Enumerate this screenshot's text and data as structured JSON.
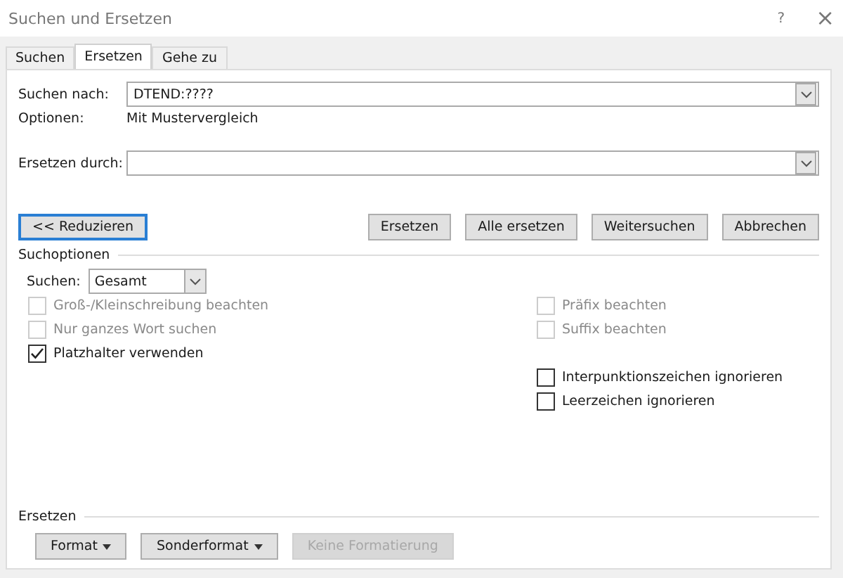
{
  "window": {
    "title": "Suchen und Ersetzen",
    "help": "?",
    "close": "×"
  },
  "tabs": [
    {
      "label": "Suchen",
      "selected": false
    },
    {
      "label": "Ersetzen",
      "selected": true
    },
    {
      "label": "Gehe zu",
      "selected": false
    }
  ],
  "search_field": {
    "label": "Suchen nach:",
    "value": "DTEND:????"
  },
  "options_info": {
    "label": "Optionen:",
    "value": "Mit Mustervergleich"
  },
  "replace_field": {
    "label": "Ersetzen durch:"
  },
  "reduce_button": {
    "label": "<< Reduzieren",
    "focused": true
  },
  "action_buttons": [
    "Ersetzen",
    "Alle ersetzen",
    "Weitersuchen",
    "Abbrechen"
  ],
  "search_options": {
    "title": "Suchoptionen",
    "direction_label": "Suchen:",
    "direction_value": "Gesamt",
    "left_options": [
      {
        "label": "Groß-/Kleinschreibung beachten",
        "checked": false,
        "disabled": true
      },
      {
        "label": "Nur ganzes Wort suchen",
        "checked": false,
        "disabled": true
      },
      {
        "label": "Platzhalter verwenden",
        "checked": true,
        "disabled": false
      }
    ],
    "right_options": [
      {
        "label": "Präfix beachten",
        "checked": false,
        "disabled": true
      },
      {
        "label": "Suffix beachten",
        "checked": false,
        "disabled": true
      },
      {
        "label": "Interpunktionszeichen ignorieren",
        "checked": false,
        "disabled": false
      },
      {
        "label": "Leerzeichen ignorieren",
        "checked": false,
        "disabled": false
      }
    ]
  },
  "replace_section": {
    "title": "Ersetzen",
    "buttons": [
      {
        "label": "Format",
        "dropdown": true,
        "disabled": false
      },
      {
        "label": "Sonderformat",
        "dropdown": true,
        "disabled": false
      },
      {
        "label": "Keine Formatierung",
        "dropdown": false,
        "disabled": true
      }
    ]
  }
}
